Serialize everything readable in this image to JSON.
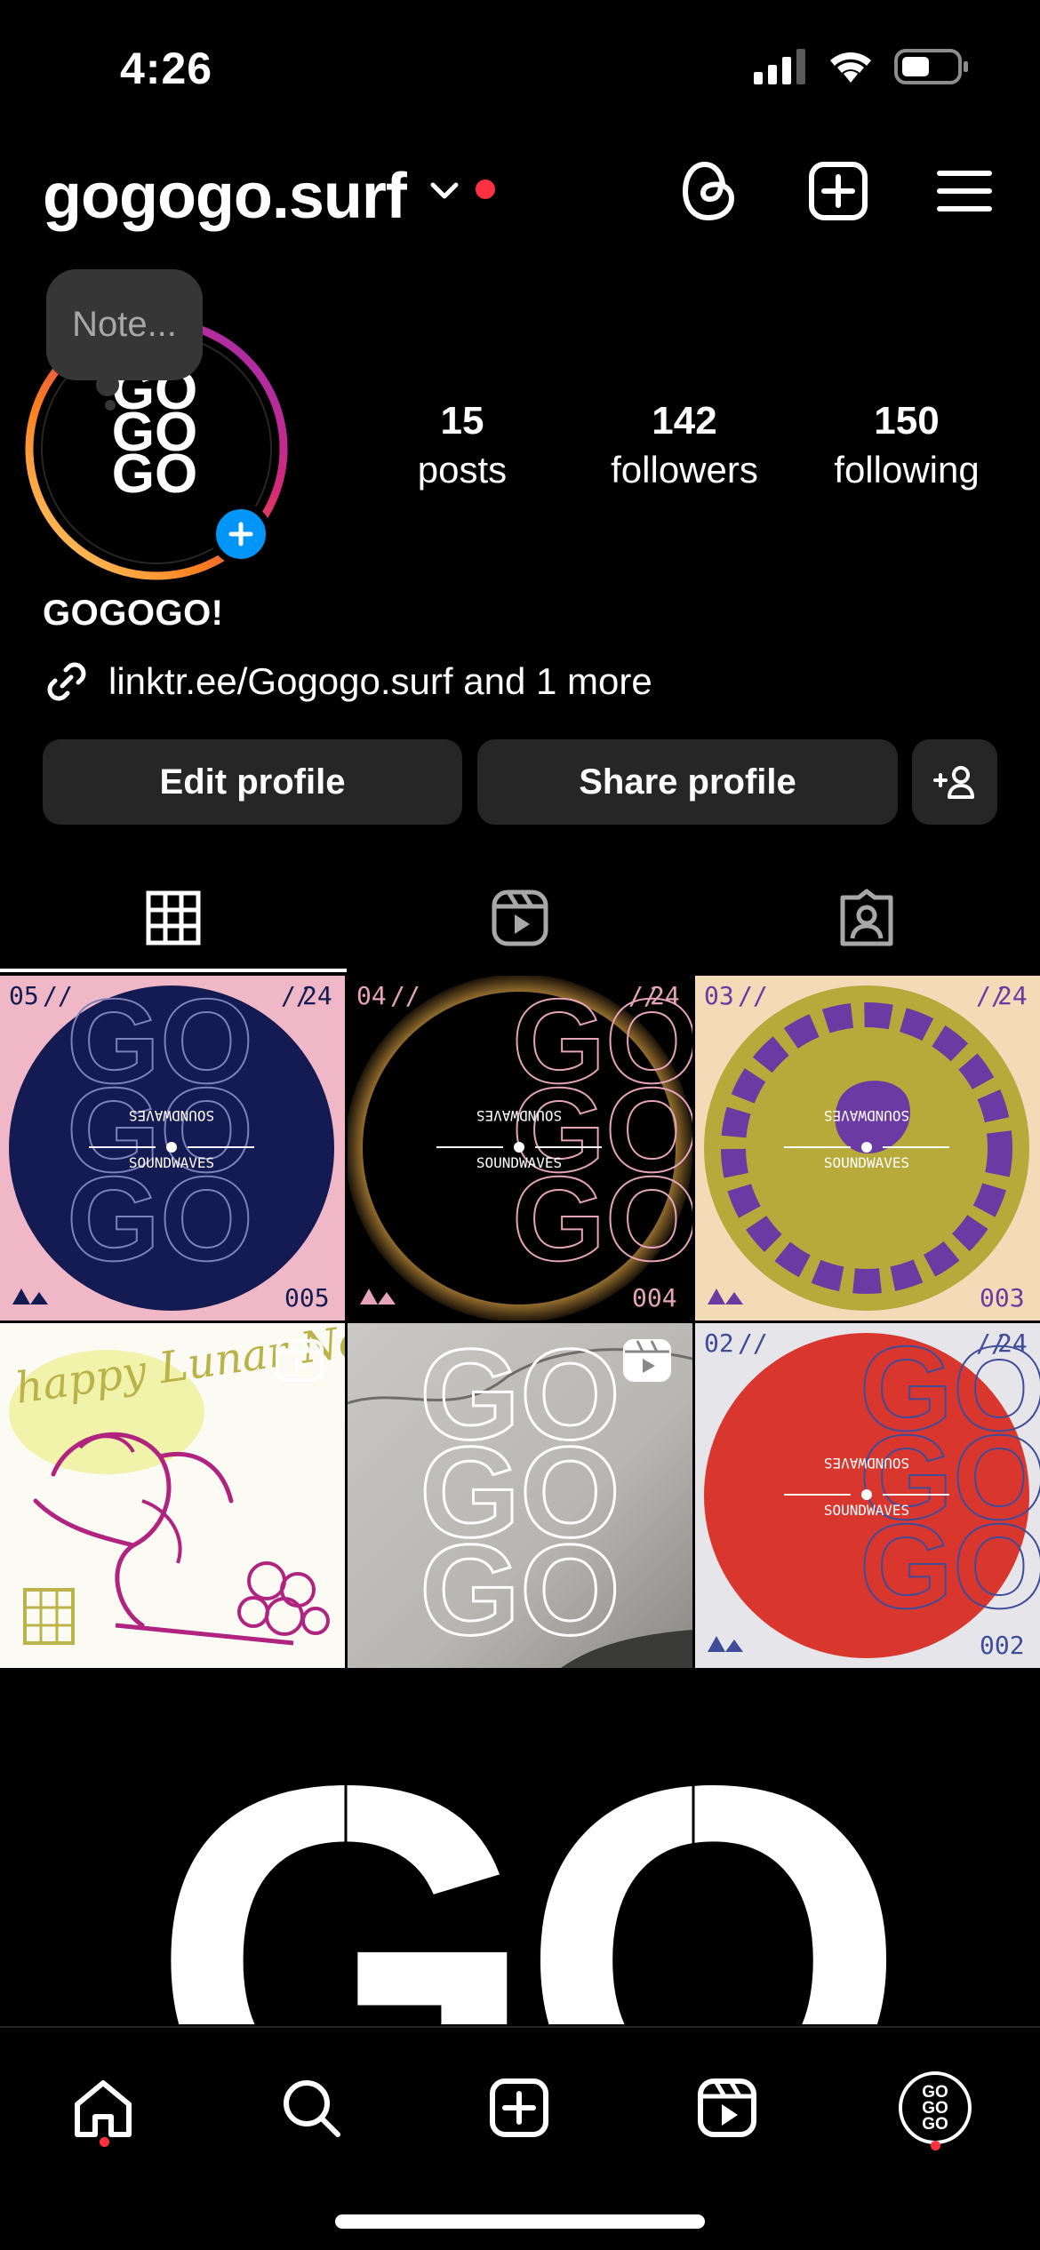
{
  "status_bar": {
    "time": "4:26"
  },
  "header": {
    "username": "gogogo.surf",
    "icons": [
      "threads-icon",
      "create-post-icon",
      "menu-icon"
    ]
  },
  "profile": {
    "note_placeholder": "Note...",
    "avatar_text": "GO GO GO",
    "display_name": "GOGOGO!",
    "link_text": "linktr.ee/Gogogo.surf and 1 more",
    "stats": [
      {
        "num": "15",
        "label": "posts"
      },
      {
        "num": "142",
        "label": "followers"
      },
      {
        "num": "150",
        "label": "following"
      }
    ],
    "buttons": {
      "edit": "Edit profile",
      "share": "Share profile"
    }
  },
  "tabs": [
    "grid-tab",
    "reels-tab",
    "tagged-tab"
  ],
  "posts": [
    {
      "issue": "05",
      "year": "24",
      "num": "005",
      "title": "SOUNDWAVES",
      "bg": "#f0b8c6",
      "circle": "#141a52",
      "stroke": "#7c82b8"
    },
    {
      "issue": "04",
      "year": "24",
      "num": "004",
      "title": "SOUNDWAVES",
      "bg": "#000000",
      "circle": "#000000",
      "stroke": "#e6a3bc"
    },
    {
      "issue": "03",
      "year": "24",
      "num": "003",
      "title": "SOUNDWAVES",
      "bg": "#f3dbb7",
      "circle": "#b8a93b",
      "stroke": "#6c3aa3"
    },
    {
      "caption": "happy Lunar New Year"
    },
    {
      "caption": ""
    },
    {
      "issue": "02",
      "year": "24",
      "num": "002",
      "title": "SOUNDWAVES",
      "bg": "#e5e5ea",
      "circle": "#d9362e",
      "stroke": "#3f4c99"
    }
  ],
  "big_post_text": "GO"
}
